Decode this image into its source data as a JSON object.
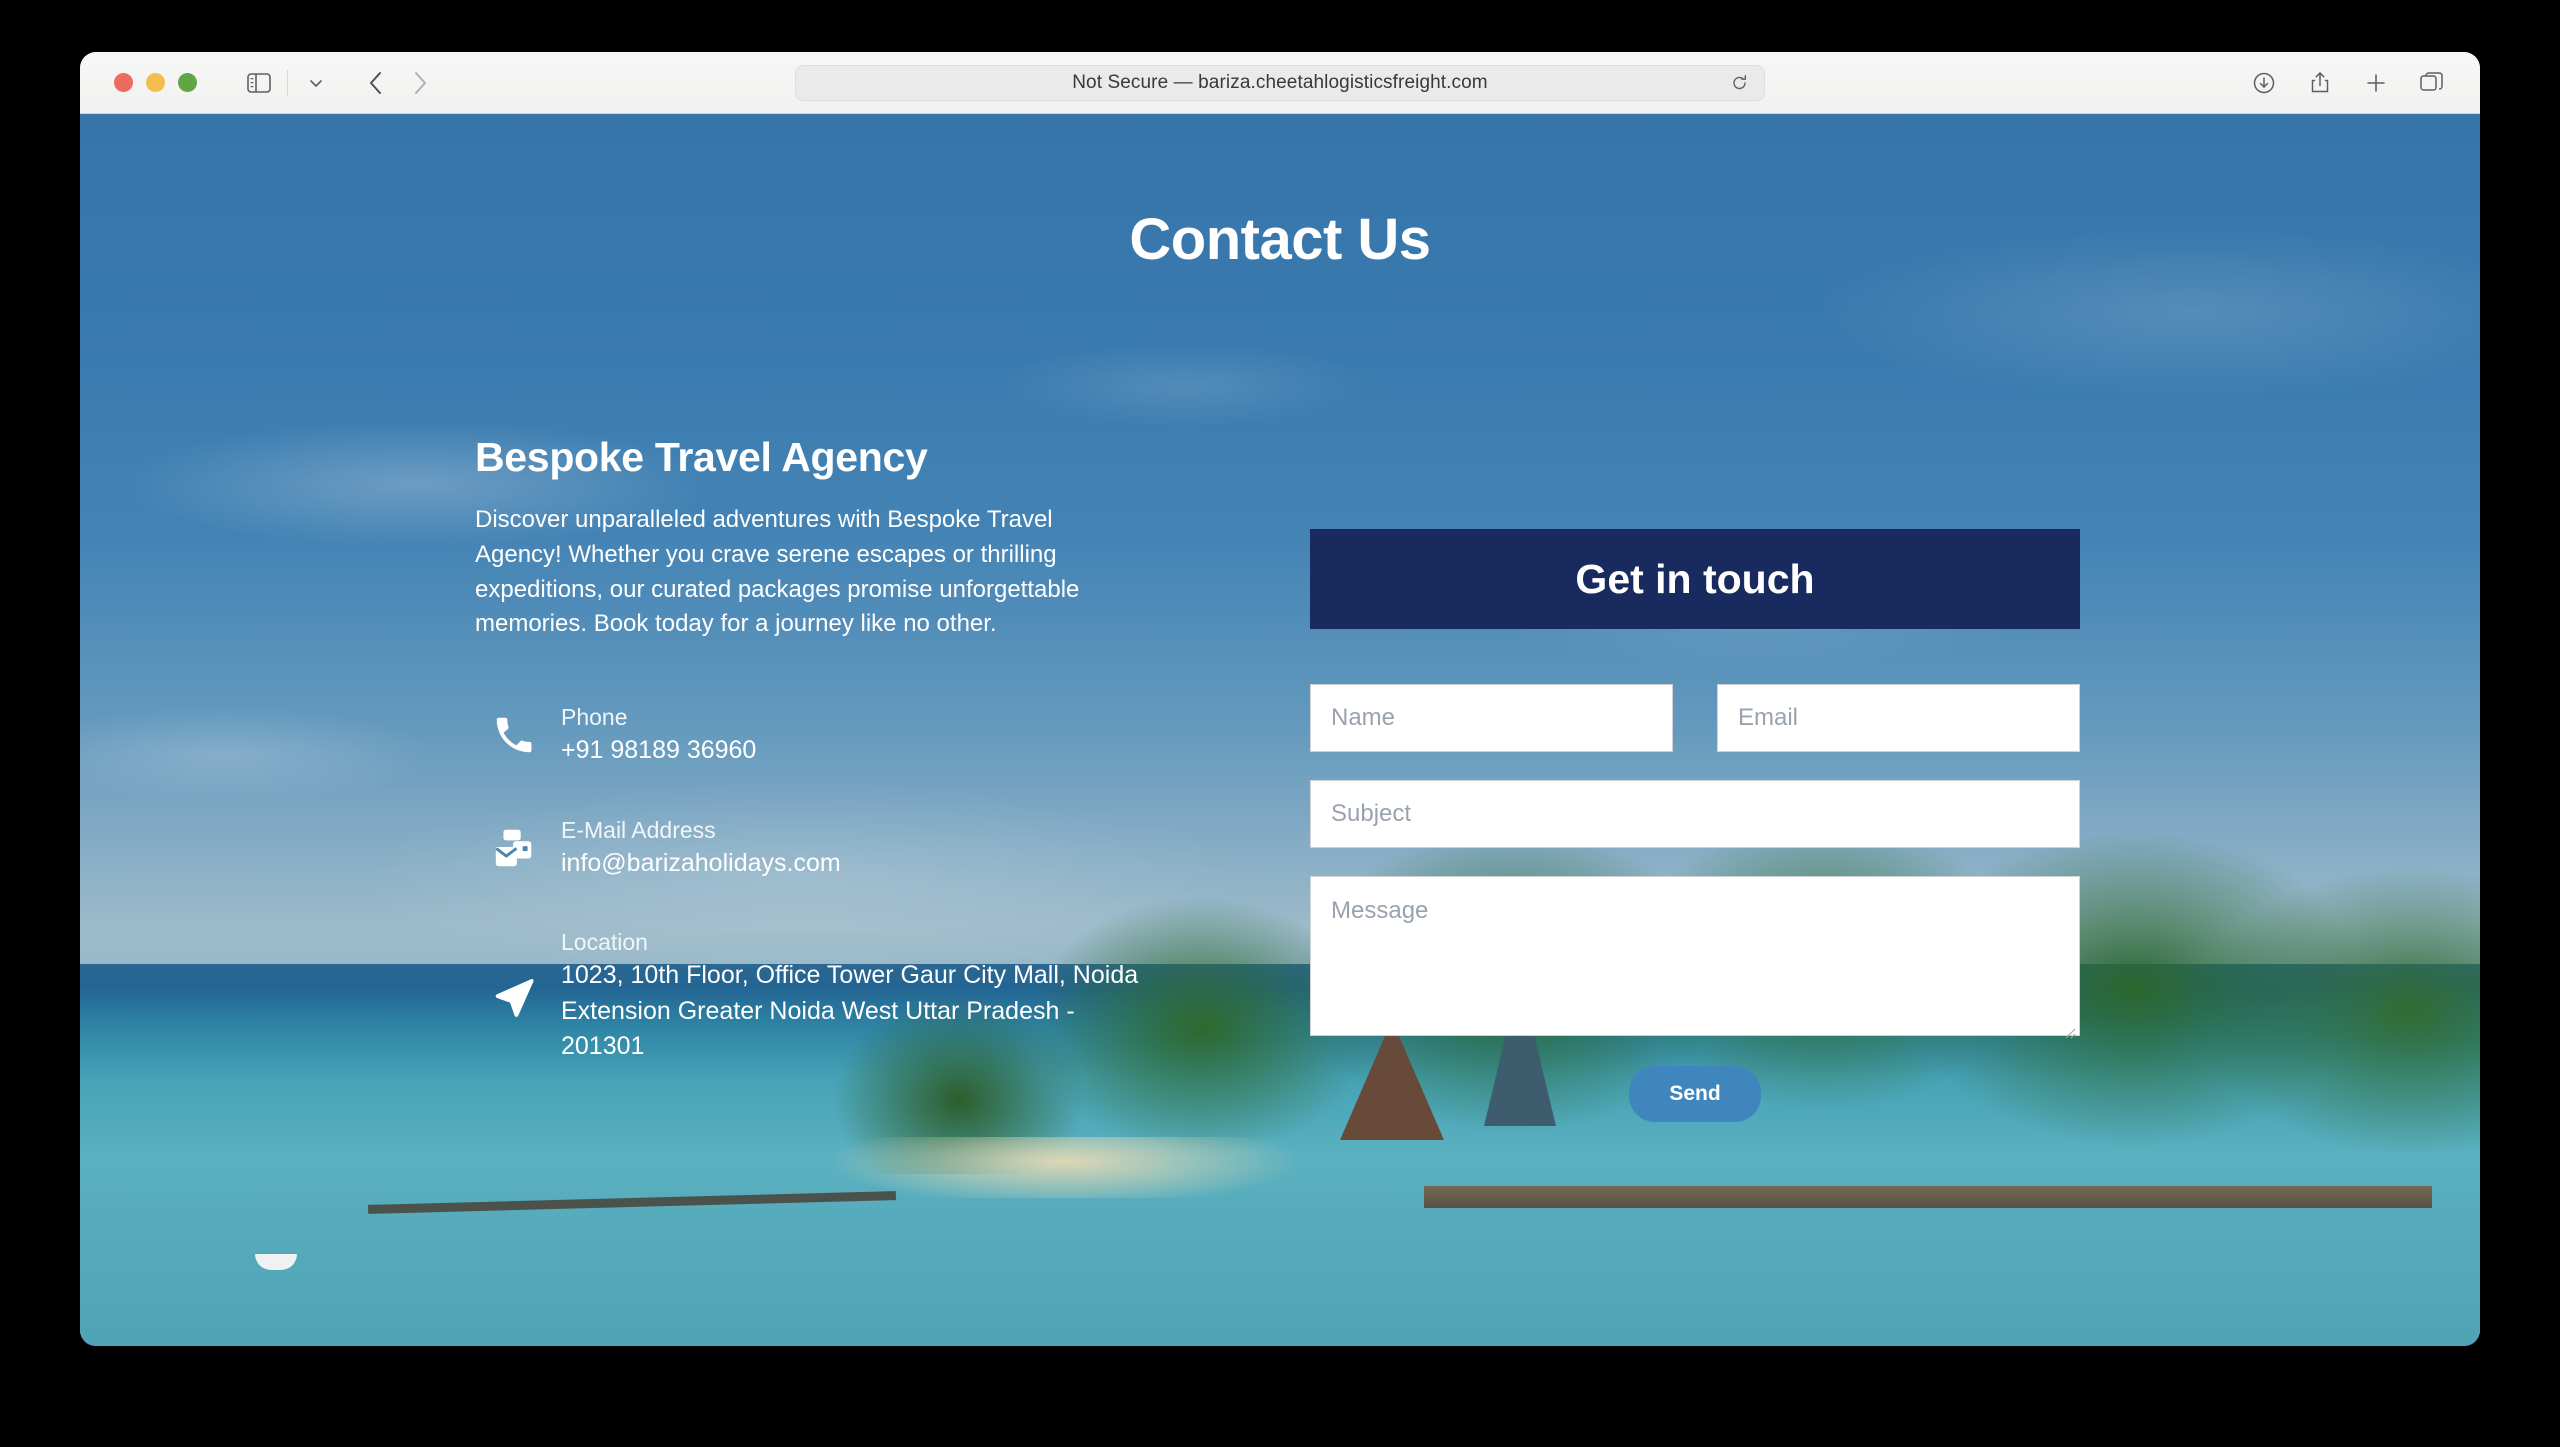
{
  "browser": {
    "traffic_lights": [
      "close",
      "minimize",
      "zoom"
    ],
    "sidebar_icon": "sidebar-icon",
    "chevron_icon": "chevron-down-icon",
    "back_icon": "chevron-left-icon",
    "forward_icon": "chevron-right-icon",
    "url": "Not Secure — bariza.cheetahlogisticsfreight.com",
    "reload_icon": "reload-icon",
    "right_icons": [
      "downloads-icon",
      "share-icon",
      "new-tab-icon",
      "tab-overview-icon"
    ]
  },
  "page": {
    "title": "Contact Us",
    "agency": {
      "name": "Bespoke Travel Agency",
      "description": "Discover unparalleled adventures with Bespoke Travel Agency! Whether you crave serene escapes or thrilling expeditions, our curated packages promise unforgettable memories. Book today for a journey like no other."
    },
    "contacts": [
      {
        "icon": "phone-icon",
        "label": "Phone",
        "value": "+91 98189 36960"
      },
      {
        "icon": "email-icon",
        "label": "E-Mail Address",
        "value": "info@barizaholidays.com"
      },
      {
        "icon": "location-icon",
        "label": "Location",
        "value": "1023, 10th Floor, Office Tower Gaur City Mall, Noida Extension Greater Noida West Uttar Pradesh - 201301"
      }
    ],
    "form": {
      "header": "Get in touch",
      "name_placeholder": "Name",
      "email_placeholder": "Email",
      "subject_placeholder": "Subject",
      "message_placeholder": "Message",
      "send_label": "Send"
    }
  },
  "colors": {
    "form_header_bg": "#192a5e",
    "send_button_bg": "#3e86bd",
    "sky_blue": "#3c7eb3",
    "sea_turquoise": "#4ea3b5",
    "text_white": "#ffffff"
  }
}
